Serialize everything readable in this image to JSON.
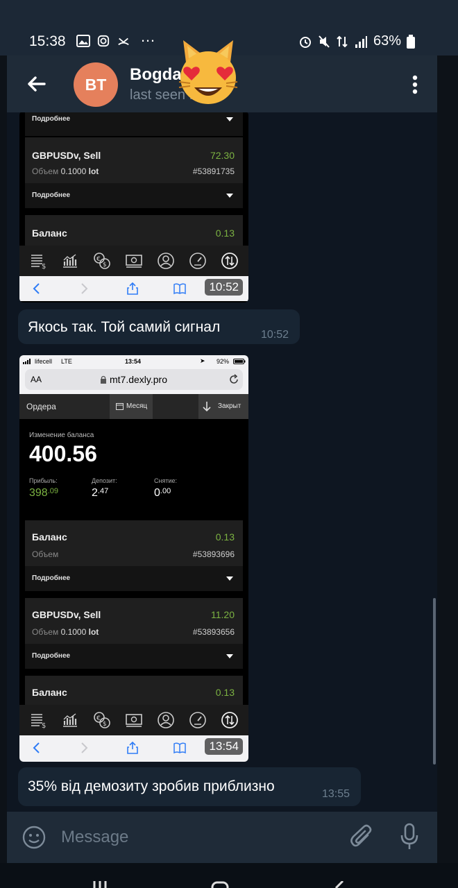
{
  "status_bar": {
    "time": "15:38",
    "dots": "…",
    "battery": "63%"
  },
  "header": {
    "avatar_initials": "BT",
    "chat_name": "Bogdan Step",
    "last_seen": "last seen 13:55"
  },
  "messages": [
    {
      "type": "screenshot",
      "time": "10:52",
      "content": {
        "more_label": "Подробнее",
        "trades": [
          {
            "title": "GBPUSDv, Sell",
            "value": "72.30",
            "volume_label": "Объем",
            "volume": "0.1000",
            "unit": "lot",
            "id": "#53891735"
          },
          {
            "title": "Баланс",
            "value": "0.13"
          }
        ]
      }
    },
    {
      "type": "text",
      "text": "Якось так. Той самий сигнал",
      "time": "10:52"
    },
    {
      "type": "screenshot",
      "time": "13:54",
      "content": {
        "ios_status": {
          "carrier": "lifecell",
          "network": "LTE",
          "time": "13:54",
          "battery": "92%"
        },
        "url_bar": {
          "aa": "AA",
          "url": "mt7.dexly.pro"
        },
        "toolbar": {
          "orders": "Ордера",
          "month": "Месяц",
          "closed": "Закрыт"
        },
        "balance_change_label": "Изменение баланса",
        "balance_change_value": "400.56",
        "stats": [
          {
            "label": "Прибыль:",
            "main": "398",
            "frac": ".09",
            "color": "#7cb342"
          },
          {
            "label": "Депозит:",
            "main": "2",
            "frac": ".47",
            "color": "#ffffff"
          },
          {
            "label": "Снятие:",
            "main": "0",
            "frac": ".00",
            "color": "#ffffff"
          }
        ],
        "more_label": "Подробнее",
        "trades": [
          {
            "title": "Баланс",
            "value": "0.13",
            "volume_label": "Объем",
            "id": "#53893696"
          },
          {
            "title": "GBPUSDv, Sell",
            "value": "11.20",
            "volume_label": "Объем",
            "volume": "0.1000",
            "unit": "lot",
            "id": "#53893656"
          },
          {
            "title": "Баланс",
            "value": "0.13"
          }
        ]
      }
    },
    {
      "type": "text",
      "text": "35% від демозиту зробив приблизно",
      "time": "13:55"
    }
  ],
  "input": {
    "placeholder": "Message"
  },
  "colors": {
    "accent_avatar": "#e5805c",
    "profit_green": "#7cb342",
    "bubble": "#182533",
    "header": "#1f2b38"
  }
}
